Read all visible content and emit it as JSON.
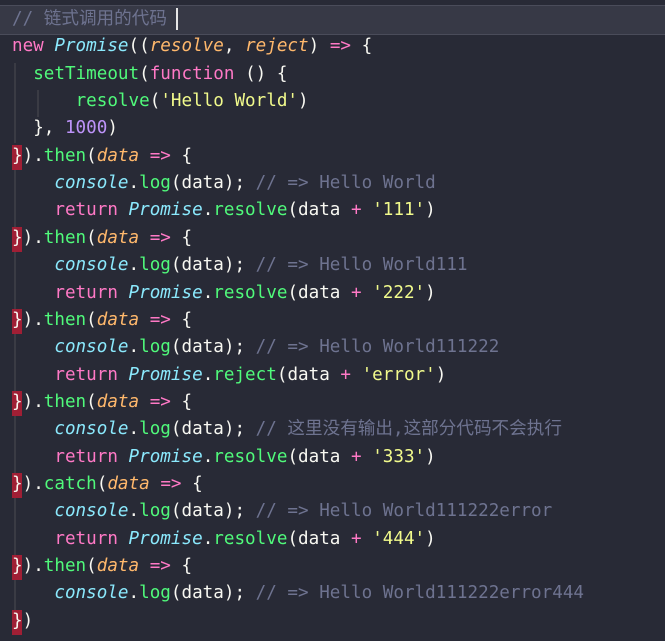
{
  "editor": {
    "lines": [
      "// 链式调用的代码",
      "new Promise((resolve, reject) => {",
      "  setTimeout(function () {",
      "      resolve('Hello World')",
      "  }, 1000)",
      "}).then(data => {",
      "    console.log(data); // => Hello World",
      "    return Promise.resolve(data + '111')",
      "}).then(data => {",
      "    console.log(data); // => Hello World111",
      "    return Promise.resolve(data + '222')",
      "}).then(data => {",
      "    console.log(data); // => Hello World111222",
      "    return Promise.reject(data + 'error')",
      "}).then(data => {",
      "    console.log(data); // 这里没有输出,这部分代码不会执行",
      "    return Promise.resolve(data + '333')",
      "}).catch(data => {",
      "    console.log(data); // => Hello World111222error",
      "    return Promise.resolve(data + '444')",
      "}).then(data => {",
      "    console.log(data); // => Hello World111222error444",
      "})"
    ]
  },
  "colors": {
    "background": "#282a36",
    "keyword": "#ff79c6",
    "class": "#8be9fd",
    "function": "#50fa7b",
    "parameter": "#ffb86c",
    "string": "#f1fa8c",
    "number": "#bd93f9",
    "comment": "#6e7390",
    "gutter_marker": "#a01f35"
  }
}
